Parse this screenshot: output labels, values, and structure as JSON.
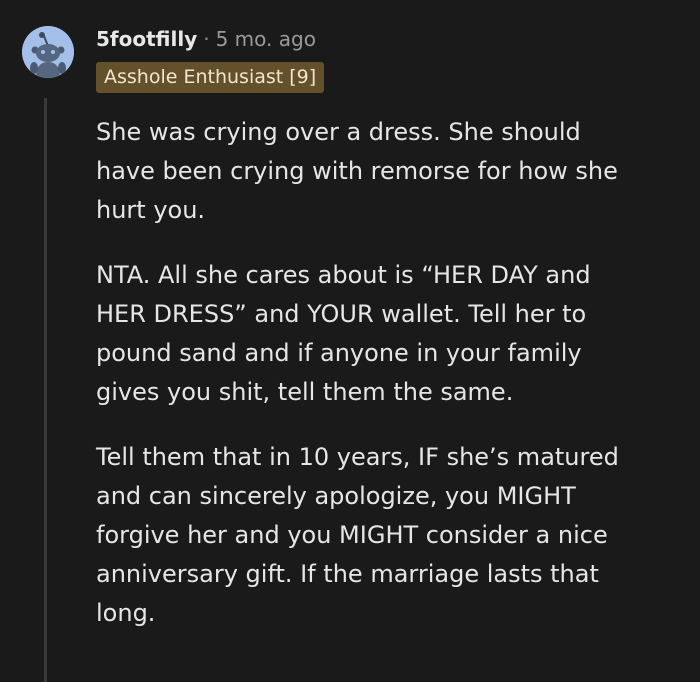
{
  "comment": {
    "author": "5footfilly",
    "separator": "·",
    "timestamp": "5 mo. ago",
    "flair": "Asshole Enthusiast [9]",
    "paragraphs": [
      {
        "lines": [
          "She was crying over a dress. She should",
          "have been crying with remorse for how she",
          "hurt you."
        ]
      },
      {
        "lines": [
          "NTA. All she cares about is “HER DAY and",
          "HER DRESS” and YOUR wallet. Tell her to",
          "pound sand and if anyone in your family",
          "gives you shit, tell them the same."
        ]
      },
      {
        "lines": [
          "Tell them that in 10 years, IF she’s matured",
          "and can sincerely apologize, you MIGHT",
          "forgive her and you MIGHT consider a nice",
          "anniversary gift. If the marriage lasts that",
          "long."
        ]
      }
    ]
  },
  "avatar": {
    "icon": "snoo-avatar-icon",
    "background": "#a5c0e8"
  },
  "colors": {
    "background": "#1a1a1b",
    "flair_background": "#65502c",
    "flair_text": "#f1e6cf",
    "body_text": "#e6e6e6",
    "meta_text": "#9a9a9a",
    "thread_line": "#3a3a3c"
  }
}
